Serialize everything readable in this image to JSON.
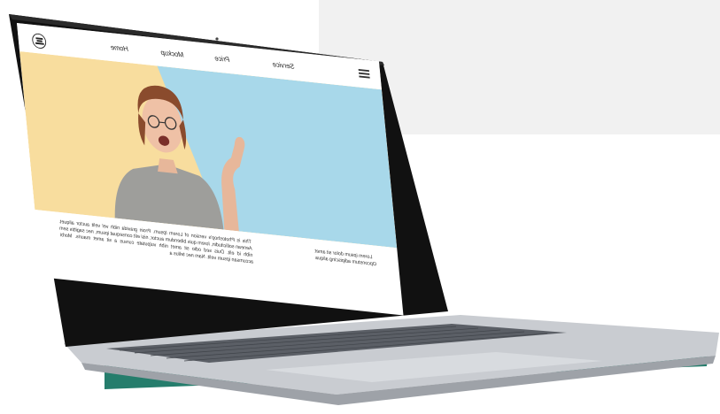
{
  "nav": {
    "items": [
      {
        "label": "Home"
      },
      {
        "label": "Mockup"
      },
      {
        "label": "Price"
      },
      {
        "label": "Service"
      }
    ]
  },
  "content": {
    "left_text": "Lorem ipsum dolor sit amet Opconstum adipiscing aliqua",
    "right_text": "This is Photoshop's version of Lorem Ipsum. Proin gravida nibh vel velit auctor aliquet. Aenean sollicitudin, lorem quis bibendum auctor, nisi elit consequat ipsum, nec sagittis sem nibh id elit. Duis sed odio sit amet nibh vulputate cursus a sit amet mauris. Morbi accumsan ipsum velit. Nam nec tellus a"
  },
  "colors": {
    "hero_yellow": "#f8dd9e",
    "hero_blue": "#a8d8ea",
    "bezel": "#111111",
    "laptop_body": "#c9ccd1",
    "shadow": "#0d6f5c"
  },
  "icons": [
    "menu-icon",
    "logo-icon"
  ]
}
